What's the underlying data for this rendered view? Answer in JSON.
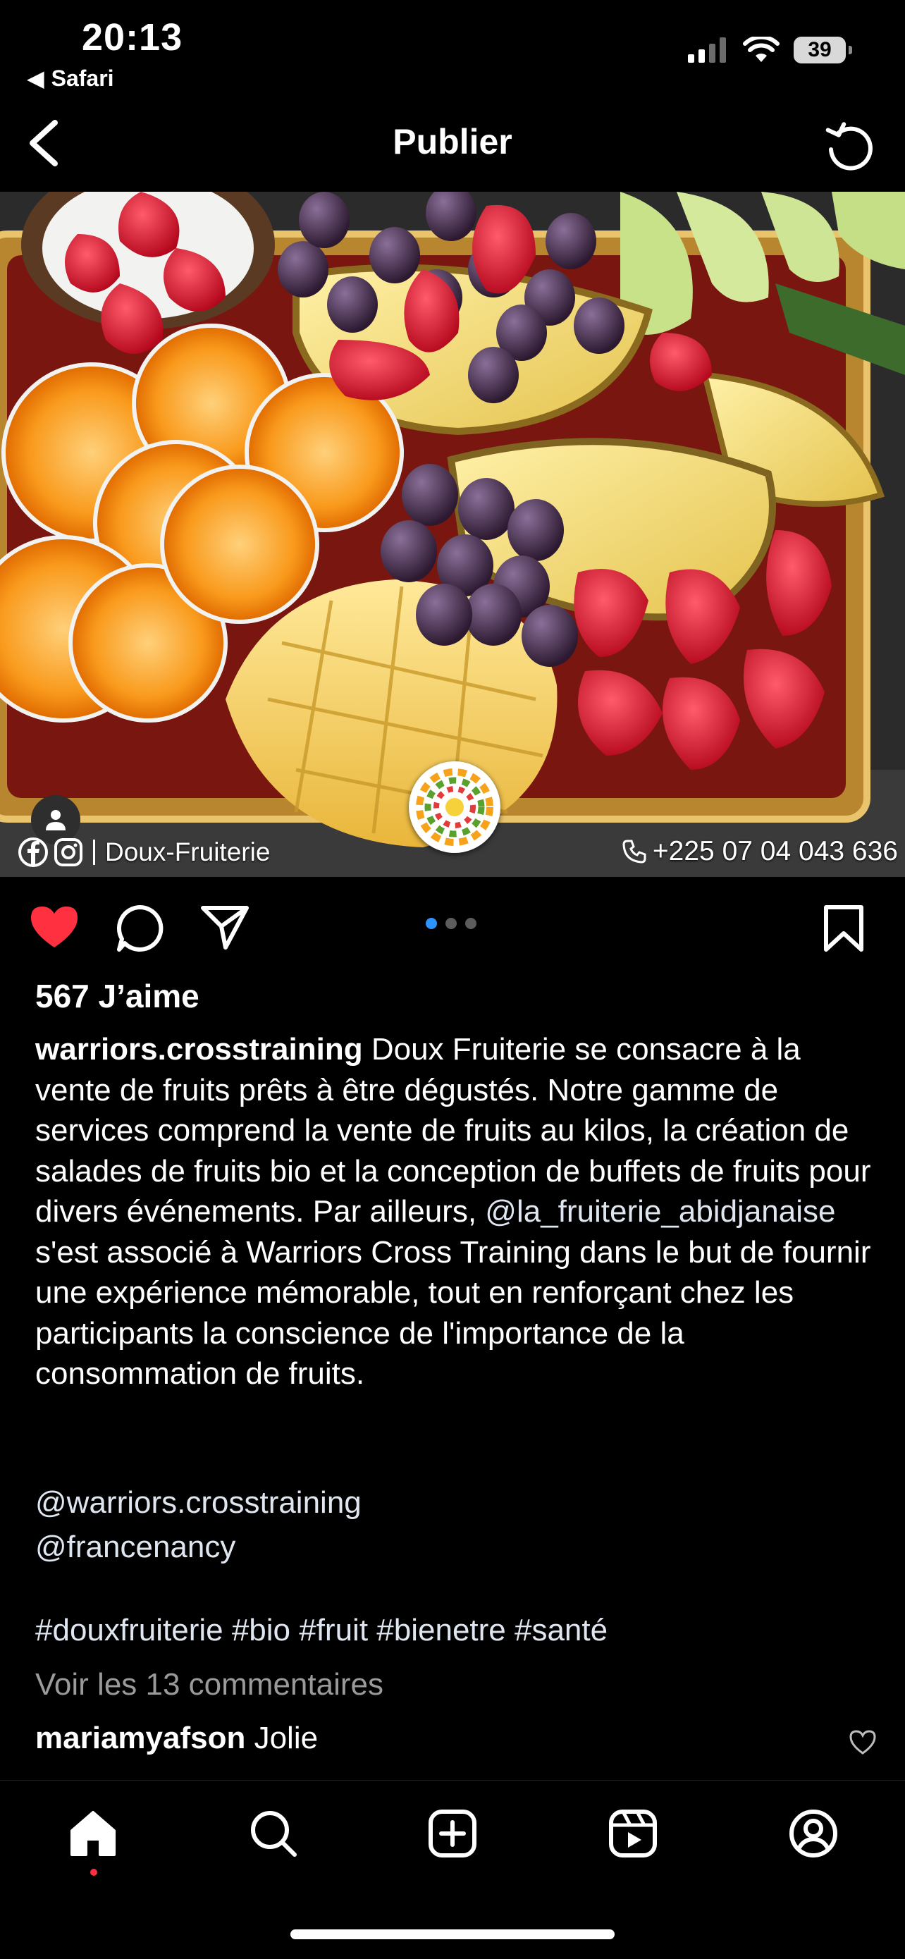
{
  "status_bar": {
    "time": "20:13",
    "back_app": "Safari",
    "battery": "39"
  },
  "nav": {
    "title": "Publier"
  },
  "post": {
    "overlay_brand": "Doux-Fruiterie",
    "overlay_phone": "+225 07 04 043 636",
    "carousel_pages": 3,
    "carousel_active": 1,
    "likes": "567 J’aime",
    "author": "warriors.crosstraining",
    "caption_a": " Doux Fruiterie se consacre à la vente de fruits prêts à être dégustés. Notre gamme de services comprend la vente de fruits au kilos, la création de salades de fruits bio et la conception de buffets de fruits pour divers événements. Par ailleurs, ",
    "caption_mention": "@la_fruiterie_abidjanaise",
    "caption_b": " s'est associé à Warriors Cross Training dans le but de fournir une expérience mémorable, tout en renforçant chez les participants la conscience de l'importance de la consommation de fruits.",
    "tag_1": "@warriors.crosstraining",
    "tag_2": "@francenancy",
    "hashtags": "#douxfruiterie #bio #fruit #bienetre #santé",
    "view_comments": "Voir les 13 commentaires",
    "comment_user": "mariamyafson",
    "comment_text": " Jolie"
  },
  "colors": {
    "like_red": "#ff3040",
    "carousel_active": "#2f93ff",
    "muted_text": "#9a9a9a"
  },
  "icons": {
    "nav_back": "chevron-left-icon",
    "nav_refresh": "refresh-icon",
    "like": "heart-filled-icon",
    "comment": "comment-icon",
    "share": "paper-plane-icon",
    "save": "bookmark-icon",
    "tabs": [
      "home-icon",
      "search-icon",
      "add-post-icon",
      "reels-icon",
      "profile-icon"
    ]
  }
}
